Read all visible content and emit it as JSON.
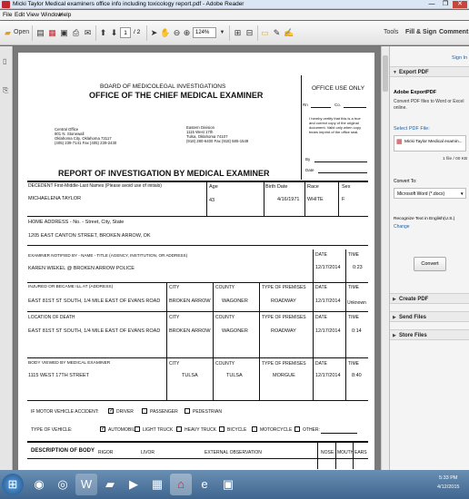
{
  "window": {
    "title": "Micki Taylor Medical examiners office info including toxicology report.pdf - Adobe Reader",
    "minimize": "—",
    "maximize": "❐",
    "close": "✕"
  },
  "menu": [
    "File",
    "Edit",
    "View",
    "Window",
    "Help"
  ],
  "toolbar": {
    "open_label": "Open",
    "page_current": "1",
    "page_total": "/ 2",
    "zoom": "124%",
    "tools": "Tools",
    "fill_sign": "Fill & Sign",
    "comment": "Comment"
  },
  "doc": {
    "board": "BOARD OF MEDICOLEGAL INVESTIGATIONS",
    "office": "OFFICE OF THE CHIEF MEDICAL EXAMINER",
    "office_use": "OFFICE USE ONLY",
    "central": [
      "Central Office",
      "901 N. Stonewall",
      "Oklahoma City, Oklahoma 73117",
      "(405) 239-7141   Fax (405) 239-2430"
    ],
    "eastern": [
      "Eastern Division",
      "1115 West 17th",
      "Tulsa, Oklahoma   74107",
      "(918) 280-6400   Fax (918) 585-1549"
    ],
    "rn_label": "Rn",
    "co_label": "Co.",
    "certify": [
      "I hereby certify that this is a true",
      "and correct copy of the original",
      "document.  Valid only when copy",
      "bears imprint of the office seal."
    ],
    "by_label": "By",
    "date_label": "Date",
    "report_title": "REPORT OF INVESTIGATION BY MEDICAL EXAMINER",
    "decedent_label": "DECEDENT First-Middle-Last Names (Please avoid use of initials)",
    "decedent_value": "MICHAELENA   TAYLOR",
    "age_label": "Age",
    "age_value": "43",
    "birth_label": "Birth Date",
    "birth_value": "4/16/1971",
    "race_label": "Race",
    "race_value": "WHITE",
    "sex_label": "Sex",
    "sex_value": "F",
    "home_label": "HOME ADDRESS - No. - Street, City, State",
    "home_value": "1205 EAST CANTON STREET, BROKEN ARROW, OK",
    "notified_label": "EXAMINER NOTIFIED BY - NAME - TITLE (AGENCY, INSTITUTION, OR ADDRESS)",
    "notified_value": "KAREN WIEKEL @ BROKEN ARROW POLICE",
    "date_h": "DATE",
    "time_h": "TIME",
    "notified_date": "12/17/2014",
    "notified_time": "0:23",
    "injured_label": "INJURED OR BECAME ILL AT (ADDRESS)",
    "injured_value": "EAST 81ST ST SOUTH, 1/4 MILE EAST OF EVANS ROAD",
    "city_h": "CITY",
    "county_h": "COUNTY",
    "premises_h": "TYPE OF PREMISES",
    "injured_city": "BROKEN ARROW",
    "injured_county": "WAGONER",
    "injured_premises": "ROADWAY",
    "injured_date": "12/17/2014",
    "injured_time": "Unknown",
    "death_label": "LOCATION OF DEATH",
    "death_value": "EAST 81ST ST SOUTH, 1/4 MILE EAST OF EVANS ROAD",
    "death_city": "BROKEN ARROW",
    "death_county": "WAGONER",
    "death_premises": "ROADWAY",
    "death_date": "12/17/2014",
    "death_time": "0:14",
    "viewed_label": "BODY VIEWED BY MEDICAL EXAMINER",
    "viewed_value": "1115 WEST 17TH STREET",
    "viewed_city": "TULSA",
    "viewed_county": "TULSA",
    "viewed_premises": "MORGUE",
    "viewed_date": "12/17/2014",
    "viewed_time": "8:40",
    "mva_label": "IF MOTOR VEHICLE ACCIDENT:",
    "driver": "DRIVER",
    "passenger": "PASSENGER",
    "pedestrian": "PEDESTRIAN",
    "vehicle_label": "TYPE OF VEHICLE:",
    "automobile": "AUTOMOBILE",
    "light_truck": "LIGHT TRUCK",
    "heavy_truck": "HEAVY TRUCK",
    "bicycle": "BICYCLE",
    "motorcycle": "MOTORCYCLE",
    "other": "OTHER:",
    "desc_body": "DESCRIPTION OF BODY",
    "rigor": "RIGOR",
    "livor": "LIVOR",
    "external": "EXTERNAL OBSERVATION",
    "nose": "NOSE",
    "mouth": "MOUTH",
    "ears": "EARS",
    "check_mark": "✓"
  },
  "right_pane": {
    "sign_in": "Sign In",
    "export_pdf": "Export PDF",
    "adobe_export": "Adobe ExportPDF",
    "convert_desc": [
      "Convert PDF files to Word or Excel",
      "online."
    ],
    "select_file": "Select PDF File:",
    "file_name": "Micki Taylor Medical examin...",
    "file_count": "1 file / 00 KB",
    "convert_to": "Convert To:",
    "format": "Microsoft Word (*.docx)",
    "recognize": "Recognize Text in English(U.S.)",
    "change": "Change",
    "convert_btn": "Convert",
    "create_pdf": "Create PDF",
    "send_files": "Send Files",
    "store_files": "Store Files"
  },
  "taskbar": {
    "time": "5:33 PM",
    "date": "4/12/2015"
  },
  "colors": {
    "adobe_red": "#c1272d",
    "link_blue": "#1d5fa8",
    "taskbar": "#4a709a"
  }
}
